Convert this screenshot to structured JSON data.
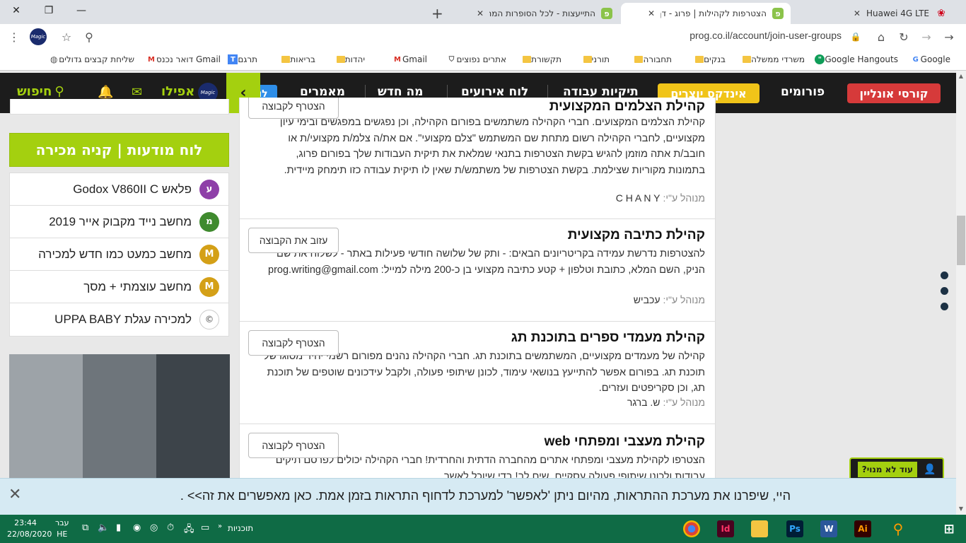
{
  "browser": {
    "window": {
      "close": "✕",
      "maximize": "❐",
      "minimize": "—"
    },
    "tabs": [
      {
        "title": "Huawei 4G LTE",
        "close": "✕"
      },
      {
        "title": "הצטרפות לקהילות | פרוג - דף הב",
        "close": "✕"
      },
      {
        "title": "התייעצות - לכל הסופרות המתחי",
        "close": "✕"
      }
    ],
    "new_tab": "+",
    "url": "prog.co.il/account/join-user-groups",
    "profile_label": "Magic"
  },
  "bookmarks": [
    {
      "label": "Google",
      "icon": "G"
    },
    {
      "label": "Google Hangouts",
      "icon": "\""
    },
    {
      "label": "משרדי ממשלה",
      "icon": "folder"
    },
    {
      "label": "בנקים",
      "icon": "folder"
    },
    {
      "label": "תחבורה",
      "icon": "folder"
    },
    {
      "label": "תורני",
      "icon": "folder"
    },
    {
      "label": "תקשורת",
      "icon": "folder"
    },
    {
      "label": "אתרים נפוצים",
      "icon": "shield"
    },
    {
      "label": "Gmail",
      "icon": "M"
    },
    {
      "label": "יהדות",
      "icon": "folder"
    },
    {
      "label": "בריאות",
      "icon": "folder"
    },
    {
      "label": "תרגם",
      "icon": "T"
    },
    {
      "label": "דואר נכנס Gmail",
      "icon": "M"
    },
    {
      "label": "שליחת קבצים גדולים",
      "icon": "globe"
    }
  ],
  "nav": {
    "items": [
      "קורסי אונליין",
      "פורומים",
      "אינדקס יוצרים",
      "תיקיות עבודה",
      "לוח אירועים",
      "מה חדש",
      "מאמרים"
    ],
    "blue_fragment": "לו",
    "user": "אפילו",
    "search": "חיפוש",
    "badge": "Magic"
  },
  "sidebar": {
    "ad_board": "לוח מודעות | קניה מכירה",
    "ads": [
      {
        "title": "פלאש Godox V860II C",
        "initial": "ע",
        "color": "#8e3fa8"
      },
      {
        "title": "מחשב נייד מקבוק אייר 2019",
        "initial": "מ",
        "color": "#3f8a2e"
      },
      {
        "title": "מחשב כמעט כמו חדש למכירה",
        "initial": "M",
        "color": "#d4a017"
      },
      {
        "title": "מחשב עוצמתי + מסך",
        "initial": "M",
        "color": "#d4a017"
      },
      {
        "title": "למכירה עגלת UPPA BABY",
        "initial": "©",
        "color": "#ffffff"
      }
    ]
  },
  "groups": [
    {
      "title": "קהילת הצלמים המקצועית",
      "desc": "קהילת הצלמים המקצועים. חברי הקהילה משתמשים בפורום הקהילה, וכן נפגשים במפגשים ובימי עיון מקצועיים, לחברי הקהילה רשום מתחת שם המשתמש \"צלם מקצועי\". אם את/ה צלמ/ת מקצועי/ת או חובב/ת אתה מוזמן להגיש בקשת הצטרפות בתנאי שמלאת את תיקית העבודות שלך בפורום פרוג, בתמונות מקוריות שצילמת. בקשת הצטרפות של משתמש/ת שאין לו תיקית עבודה כזו תימחק מיידית.",
      "manager_label": "מנוהל ע\"י:",
      "manager": "C H A N Y",
      "button": "הצטרף לקבוצה"
    },
    {
      "title": "קהילת כתיבה מקצועית",
      "desc": "להצטרפות נדרשת עמידה בקריטריונים הבאים: - ותק של שלושה חודשי פעילות באתר - לשלוח את שם הניק, השם המלא, כתובת וטלפון + קטע כתיבה מקצועי בן כ-200 מילה למייל: prog.writing@gmail.com",
      "manager_label": "מנוהל ע\"י:",
      "manager": "עכביש",
      "button": "עזוב את הקבוצה"
    },
    {
      "title": "קהילת מעמדי ספרים בתוכנת תג",
      "desc": "קהילה של מעמדים מקצועיים, המשתמשים בתוכנת תג. חברי הקהילה נהנים מפורום רשמי יחיד מסוגו של תוכנת תג. בפורום אפשר להתייעץ בנושאי עימוד, לכונן שיתופי פעולה, ולקבל עידכונים שוטפים של תוכנת תג, וכן סקריפטים ועזרים.",
      "manager_label": "מנוהל ע\"י:",
      "manager": "ש. ברגר",
      "button": "הצטרף לקבוצה"
    },
    {
      "title": "קהילת מעצבי ומפתחי web",
      "desc": "הצטרפו לקהילת מעצבי ומפתחי אתרים מהחברה הדתית והחרדית! חברי הקהילה יכולים לפרסם תיקים עבודות ולכונן שיתופי פעולה עסקיים. שים לב! בדי שיוכל לאשר",
      "button": "הצטרף לקבוצה"
    }
  ],
  "help": {
    "text": "עוד לא מנוי?"
  },
  "notification": {
    "text": "היי, שיפרנו את מערכת ההתראות, מהיום ניתן 'לאפשר' למערכת לדחוף התראות בזמן אמת. כאן מאפשרים את זה>> .",
    "close": "✕"
  },
  "taskbar": {
    "time": "23:44",
    "date": "22/08/2020",
    "lang_top": "עבר",
    "lang_bottom": "HE",
    "programs": "תוכניות",
    "apps": [
      "chrome",
      "Id",
      "folder",
      "Ps",
      "W",
      "Ai",
      "search",
      "windows"
    ]
  }
}
